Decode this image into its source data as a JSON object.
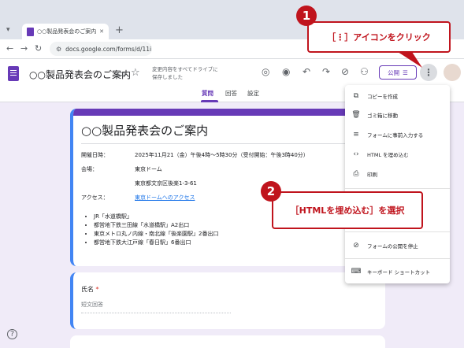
{
  "browser": {
    "tab_title": "○○製品発表会のご案内 - Goog",
    "url": "docs.google.com/forms/d/11i"
  },
  "header": {
    "title": "○○製品発表会のご案内",
    "save_note": "変更内容をすべてドライブに保存しました",
    "publish_label": "公開"
  },
  "form_tabs": [
    "質問",
    "回答",
    "設定"
  ],
  "form": {
    "title": "○○製品発表会のご案内",
    "details": [
      {
        "label": "開催日時：",
        "value": "2025年11月21（金）午後4時〜5時30分（受付開始：午後3時40分）"
      },
      {
        "label": "会場：",
        "value": "東京ドーム"
      },
      {
        "label": "",
        "value": "東京都文京区後楽1-3-61"
      },
      {
        "label": "アクセス：",
        "value": "東京ドームへのアクセス"
      }
    ],
    "access_items": [
      "JR「水道橋駅」",
      "都営地下鉄三田線「水道橋駅」A2出口",
      "東京メトロ丸ノ内線・南北線「後楽園駅」2番出口",
      "都営地下鉄大江戸線「春日駅」6番出口"
    ],
    "question_title": "氏名",
    "required_mark": "*",
    "answer_placeholder": "短文回答"
  },
  "menu": {
    "items": [
      {
        "label": "コピーを作成",
        "icon": "copy-icon"
      },
      {
        "label": "ゴミ箱に移動",
        "icon": "trash-icon"
      },
      {
        "label": "フォームに事前入力する",
        "icon": "prefill-icon"
      },
      {
        "label": "HTML を埋め込む",
        "icon": "code-icon"
      },
      {
        "label": "印刷",
        "icon": "print-icon"
      },
      {
        "label": "フォームの公開を停止",
        "icon": "stop-publish-icon"
      },
      {
        "label": "キーボード ショートカット",
        "icon": "keyboard-icon"
      }
    ]
  },
  "annotations": {
    "step1_number": "1",
    "step1_text": "［⋮］アイコンをクリック",
    "step2_number": "2",
    "step2_text": "［HTMLを埋め込む］を選択"
  }
}
